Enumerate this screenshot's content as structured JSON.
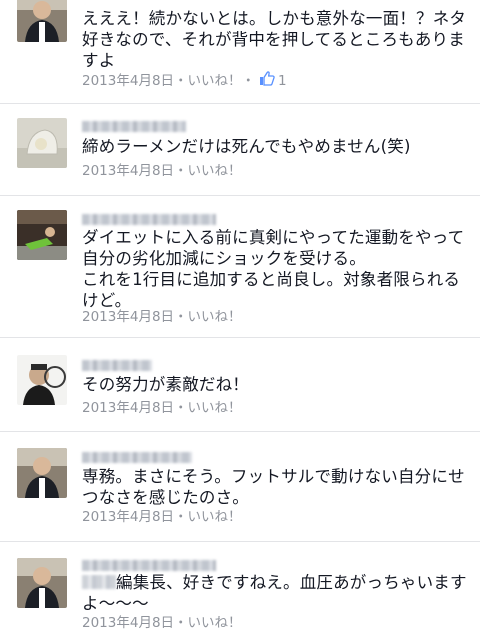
{
  "comments": [
    {
      "text": "えええ！続かないとは。しかも意外な一面！？ネタ好きなので、それが背中を押してるところもありますよ",
      "date": "2013年4月8日",
      "dot": "・",
      "like": "いいね！",
      "dot2": "・",
      "like_count": "1"
    },
    {
      "text": "締めラーメンだけは死んでもやめません(笑)",
      "date": "2013年4月8日",
      "dot": "・",
      "like": "いいね！"
    },
    {
      "text": "ダイエットに入る前に真剣にやってた運動をやって自分の劣化加減にショックを受ける。\nこれを1行目に追加すると尚良し。対象者限られるけど。",
      "date": "2013年4月8日",
      "dot": "・",
      "like": "いいね！"
    },
    {
      "text": "その努力が素敵だね！",
      "date": "2013年4月8日",
      "dot": "・",
      "like": "いいね！"
    },
    {
      "text": "専務。まさにそう。フットサルで動けない自分にせつなさを感じたのさ。",
      "date": "2013年4月8日",
      "dot": "・",
      "like": "いいね！"
    },
    {
      "text": "編集長、好きですねえ。血圧あがっちゃいますよ〜〜〜",
      "date": "2013年4月8日",
      "dot": "・",
      "like": "いいね！"
    }
  ],
  "colors": {
    "meta": "#90949c",
    "like_icon": "#5890ff",
    "separator": "#e3e4e7"
  },
  "icons": {
    "like": "thumbs-up-icon"
  }
}
